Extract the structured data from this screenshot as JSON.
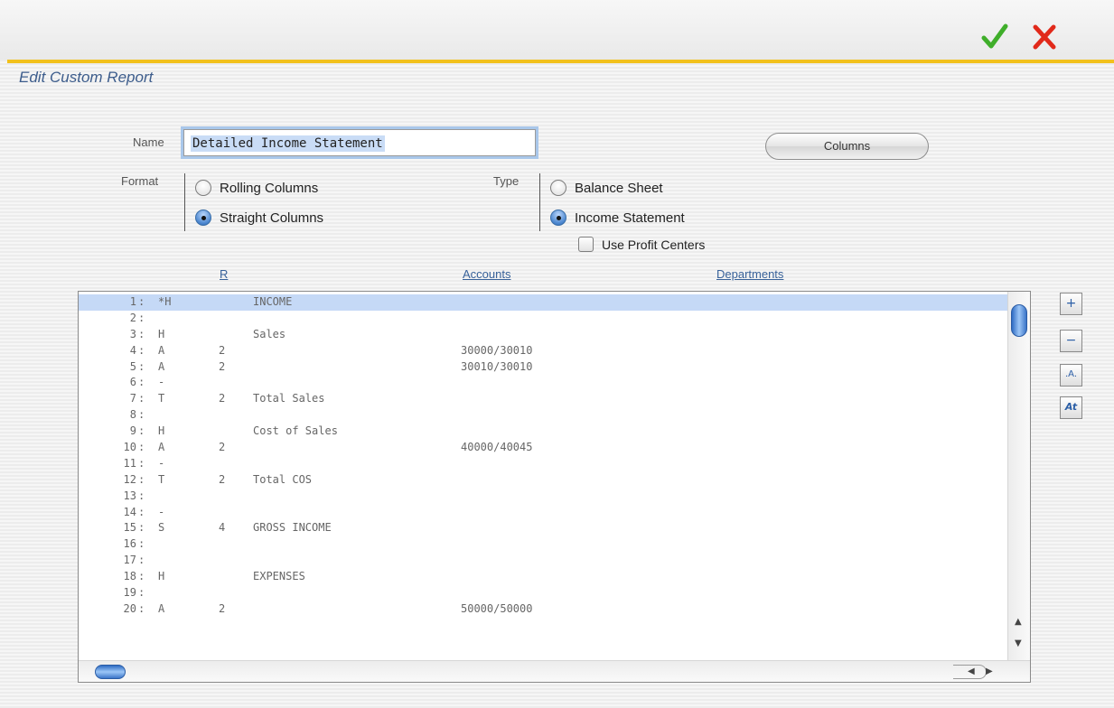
{
  "header": {
    "ok_icon": "checkmark-icon",
    "cancel_icon": "close-x-icon",
    "ok_color": "#3fae2a",
    "cancel_color": "#e1291a",
    "accent_line_color": "#f2c11d"
  },
  "page_title": "Edit Custom Report",
  "form": {
    "name_label": "Name",
    "name_value": "Detailed Income Statement",
    "columns_button": "Columns",
    "format_label": "Format",
    "format_options": [
      "Rolling Columns",
      "Straight Columns"
    ],
    "format_selected": "Straight Columns",
    "type_label": "Type",
    "type_options": [
      "Balance Sheet",
      "Income Statement"
    ],
    "type_selected": "Income Statement",
    "use_profit_centers_label": "Use Profit Centers",
    "use_profit_centers_checked": false
  },
  "table": {
    "headers": {
      "r": "R",
      "accounts": "Accounts",
      "departments": "Departments"
    },
    "selected_row": 1,
    "rows": [
      {
        "num": "1",
        "code": "*H",
        "r": "",
        "desc": "INCOME",
        "accounts": ""
      },
      {
        "num": "2",
        "code": "",
        "r": "",
        "desc": "",
        "accounts": ""
      },
      {
        "num": "3",
        "code": "H",
        "r": "",
        "desc": "Sales",
        "accounts": ""
      },
      {
        "num": "4",
        "code": "A",
        "r": "2",
        "desc": "",
        "accounts": "30000/30010"
      },
      {
        "num": "5",
        "code": "A",
        "r": "2",
        "desc": "",
        "accounts": "30010/30010"
      },
      {
        "num": "6",
        "code": "-",
        "r": "",
        "desc": "",
        "accounts": ""
      },
      {
        "num": "7",
        "code": "T",
        "r": "2",
        "desc": "Total Sales",
        "accounts": ""
      },
      {
        "num": "8",
        "code": "",
        "r": "",
        "desc": "",
        "accounts": ""
      },
      {
        "num": "9",
        "code": "H",
        "r": "",
        "desc": "Cost of Sales",
        "accounts": ""
      },
      {
        "num": "10",
        "code": "A",
        "r": "2",
        "desc": "",
        "accounts": "40000/40045"
      },
      {
        "num": "11",
        "code": "-",
        "r": "",
        "desc": "",
        "accounts": ""
      },
      {
        "num": "12",
        "code": "T",
        "r": "2",
        "desc": "Total COS",
        "accounts": ""
      },
      {
        "num": "13",
        "code": "",
        "r": "",
        "desc": "",
        "accounts": ""
      },
      {
        "num": "14",
        "code": "-",
        "r": "",
        "desc": "",
        "accounts": ""
      },
      {
        "num": "15",
        "code": "S",
        "r": "4",
        "desc": "GROSS INCOME",
        "accounts": ""
      },
      {
        "num": "16",
        "code": "",
        "r": "",
        "desc": "",
        "accounts": ""
      },
      {
        "num": "17",
        "code": "",
        "r": "",
        "desc": "",
        "accounts": ""
      },
      {
        "num": "18",
        "code": "H",
        "r": "",
        "desc": "EXPENSES",
        "accounts": ""
      },
      {
        "num": "19",
        "code": "",
        "r": "",
        "desc": "",
        "accounts": ""
      },
      {
        "num": "20",
        "code": "A",
        "r": "2",
        "desc": "",
        "accounts": "50000/50000"
      }
    ]
  },
  "side_buttons": [
    {
      "name": "add-row-button",
      "glyph": "+"
    },
    {
      "name": "remove-row-button",
      "glyph": "−"
    },
    {
      "name": "format-a-button",
      "glyph": ".A."
    },
    {
      "name": "format-at-button",
      "glyph": "At"
    }
  ]
}
